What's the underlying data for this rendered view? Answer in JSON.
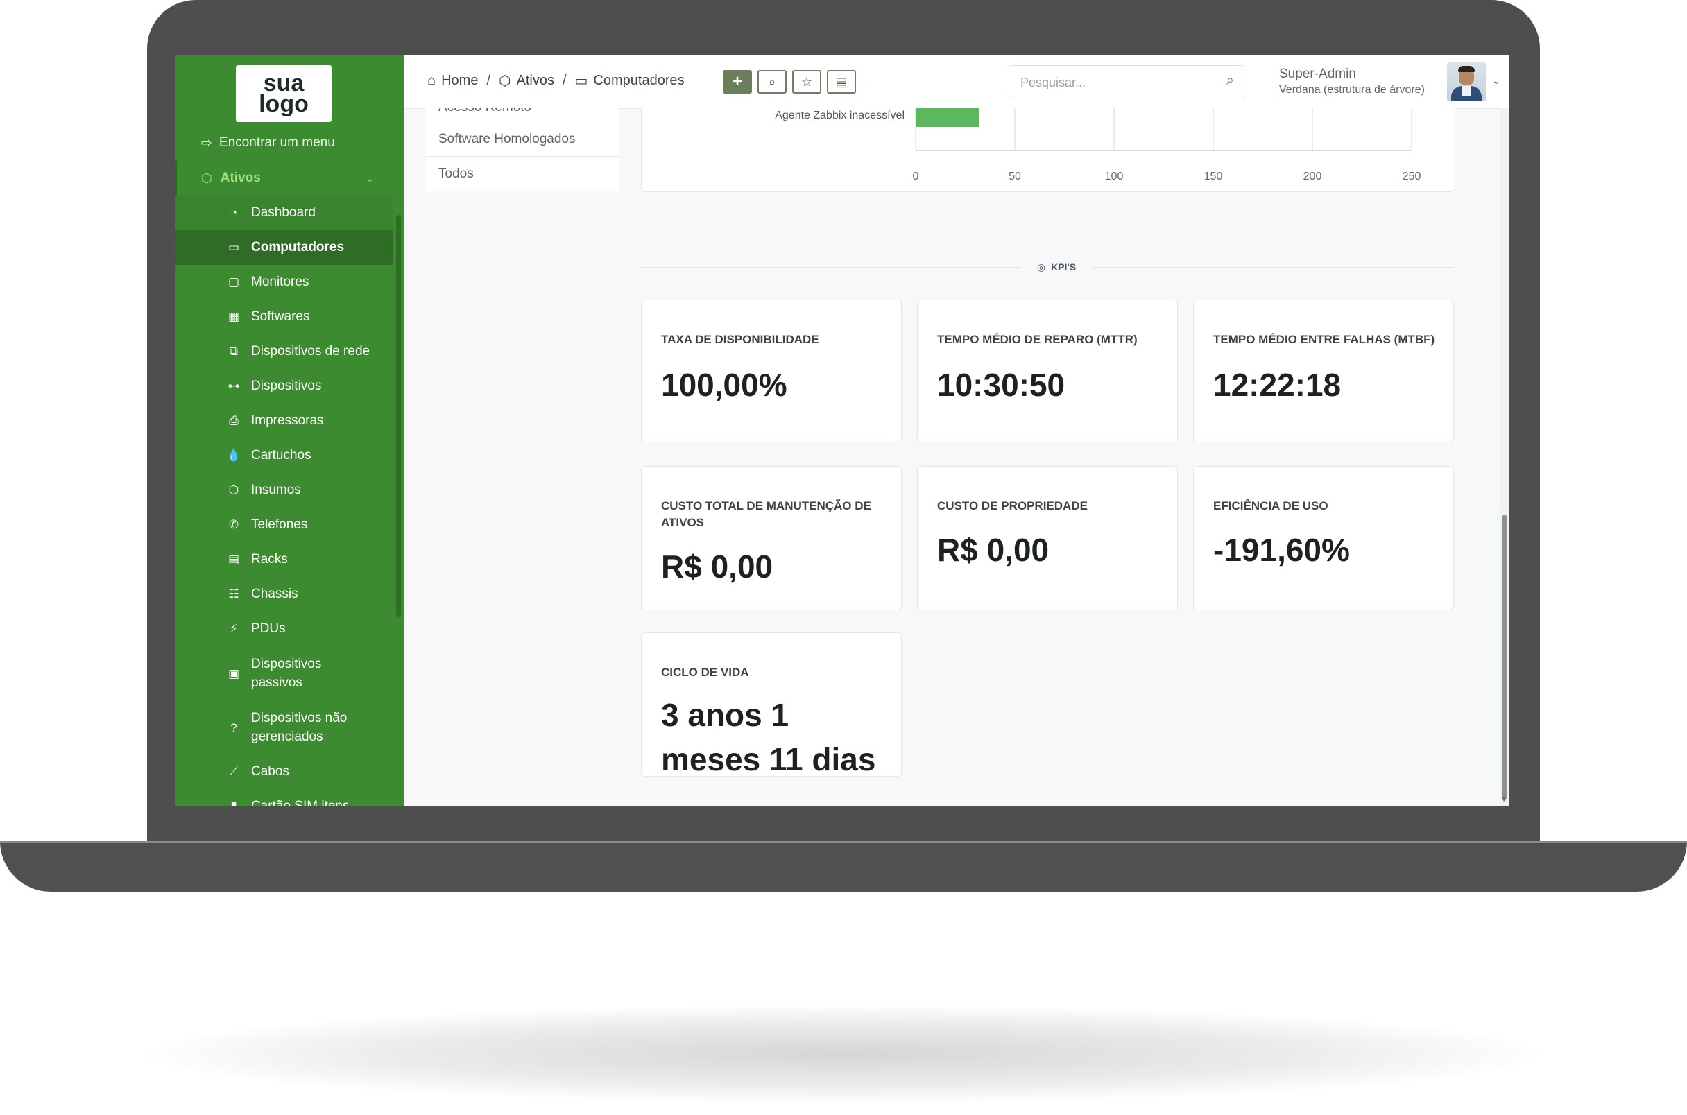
{
  "sidebar": {
    "logo_line1": "sua",
    "logo_line2": "logo",
    "find_menu": "Encontrar um menu",
    "section": "Ativos",
    "items": [
      {
        "label": "Dashboard"
      },
      {
        "label": "Computadores"
      },
      {
        "label": "Monitores"
      },
      {
        "label": "Softwares"
      },
      {
        "label": "Dispositivos de rede"
      },
      {
        "label": "Dispositivos"
      },
      {
        "label": "Impressoras"
      },
      {
        "label": "Cartuchos"
      },
      {
        "label": "Insumos"
      },
      {
        "label": "Telefones"
      },
      {
        "label": "Racks"
      },
      {
        "label": "Chassis"
      },
      {
        "label": "PDUs"
      },
      {
        "label": "Dispositivos passivos"
      },
      {
        "label": "Dispositivos não gerenciados"
      },
      {
        "label": "Cabos"
      },
      {
        "label": "Cartão SIM itens"
      }
    ]
  },
  "header": {
    "breadcrumb": [
      "Home",
      "Ativos",
      "Computadores"
    ],
    "breadcrumb_sep": "/",
    "search_placeholder": "Pesquisar...",
    "user_name": "Super-Admin",
    "user_entity": "Verdana (estrutura de árvore)"
  },
  "tabs": {
    "partial": "Acesso Remoto",
    "items": [
      "Software Homologados",
      "Todos"
    ]
  },
  "chart_data": {
    "type": "bar",
    "orientation": "horizontal",
    "categories": [
      "Agente Zabbix inacessível"
    ],
    "values": [
      32
    ],
    "bar_color": "#5cb85c",
    "xlim": [
      0,
      250
    ],
    "xticks": [
      0,
      50,
      100,
      150,
      200,
      250
    ],
    "grid": true
  },
  "kpi": {
    "section_label": "KPI'S",
    "cards": [
      {
        "label": "TAXA DE DISPONIBILIDADE",
        "value": "100,00%"
      },
      {
        "label": "TEMPO MÉDIO DE REPARO (MTTR)",
        "value": "10:30:50"
      },
      {
        "label": "TEMPO MÉDIO ENTRE FALHAS (MTBF)",
        "value": "12:22:18"
      },
      {
        "label": "CUSTO TOTAL DE MANUTENÇÃO DE ATIVOS",
        "value": "R$ 0,00"
      },
      {
        "label": "CUSTO DE PROPRIEDADE",
        "value": "R$ 0,00"
      },
      {
        "label": "EFICIÊNCIA DE USO",
        "value": "-191,60%"
      },
      {
        "label": "CICLO DE VIDA",
        "value": "3 anos 1 meses 11 dias"
      }
    ]
  },
  "colors": {
    "sidebar": "#3d8b30",
    "sidebar_active": "#2f6d26",
    "accent": "#5cb85c",
    "toolbar": "#6b7f5c"
  },
  "icons": {
    "find_menu": "sign-in-icon",
    "section": "box-icon",
    "home": "home-icon",
    "ativos": "box-icon",
    "computadores": "laptop-icon",
    "add": "plus-icon",
    "search": "search-icon",
    "bookmark": "star-icon",
    "layout": "layout-icon"
  }
}
